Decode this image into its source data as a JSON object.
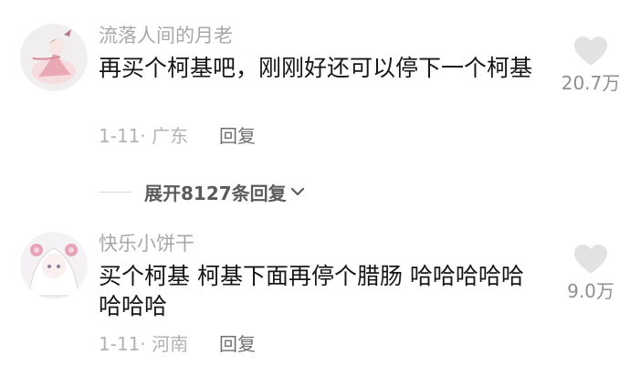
{
  "comments": [
    {
      "username": "流落人间的月老",
      "text": "再买个柯基吧，刚刚好还可以停下一个柯基",
      "date": "1-11",
      "location": "广东",
      "reply_label": "回复",
      "like_count": "20.7万",
      "avatar_icon": "avatar-anime-character-pink-icon"
    },
    {
      "username": "快乐小饼干",
      "text": "买个柯基 柯基下面再停个腊肠 哈哈哈哈哈哈哈哈",
      "date": "1-11",
      "location": "河南",
      "reply_label": "回复",
      "like_count": "9.0万",
      "avatar_icon": "avatar-anime-girl-white-hair-icon"
    }
  ],
  "expand_replies": {
    "label": "展开8127条回复",
    "icon": "chevron-down-icon"
  },
  "colors": {
    "username": "#a8a8a8",
    "text": "#161616",
    "meta": "#b2b2b2",
    "heart": "#e2e2e2"
  }
}
